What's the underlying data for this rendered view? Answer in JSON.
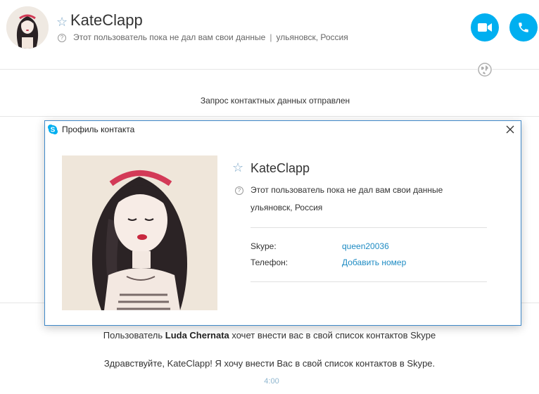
{
  "header": {
    "contact_name": "KateClapp",
    "status_text": "Этот пользователь пока не дал вам свои данные",
    "separator": "|",
    "location": "ульяновск, Россия",
    "icons": {
      "favorite": "star-outline-icon",
      "info": "question-circle-icon",
      "video": "video-camera-icon",
      "call": "phone-icon",
      "globe": "globe-icon"
    }
  },
  "chat": {
    "request_sent": "Запрос контактных данных отправлен",
    "invite_prefix": "Пользователь ",
    "invite_user": "Luda Chernata",
    "invite_suffix": " хочет внести вас в свой список контактов Skype",
    "greeting": "Здравствуйте, KateClapp! Я хочу внести Вас в свой список контактов в Skype.",
    "time": "4:00"
  },
  "dialog": {
    "title": "Профиль контакта",
    "name": "KateClapp",
    "status_text": "Этот пользователь пока не дал вам свои данные",
    "location": "ульяновск, Россия",
    "fields": [
      {
        "label": "Skype:",
        "value": "queen20036"
      },
      {
        "label": "Телефон:",
        "value": "Добавить номер"
      }
    ]
  },
  "colors": {
    "accent": "#00aff0",
    "link": "#1e8bc3",
    "dialog_border": "#3f88c8"
  }
}
